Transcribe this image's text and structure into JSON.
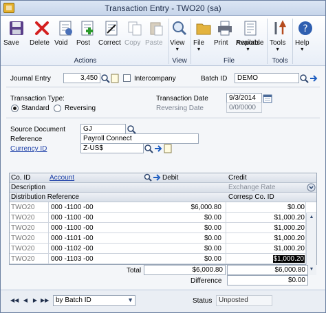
{
  "window": {
    "title": "Transaction Entry  -  TWO20 (sa)"
  },
  "ribbon": {
    "save": "Save",
    "delete": "Delete",
    "void": "Void",
    "post": "Post",
    "correct": "Correct",
    "copy": "Copy",
    "paste": "Paste",
    "view": "View",
    "file": "File",
    "print": "Print",
    "available_reports_1": "Available",
    "available_reports_2": "Reports",
    "tools": "Tools",
    "help": "Help",
    "group_actions": "Actions",
    "group_view": "View",
    "group_file": "File",
    "group_tools": "Tools"
  },
  "header": {
    "journal_entry_label": "Journal Entry",
    "journal_entry_value": "3,450",
    "intercompany_label": "Intercompany",
    "batch_id_label": "Batch ID",
    "batch_id_value": "DEMO",
    "transaction_type_label": "Transaction Type:",
    "standard_label": "Standard",
    "reversing_label": "Reversing",
    "transaction_date_label": "Transaction Date",
    "transaction_date_value": "9/3/2014",
    "reversing_date_label": "Reversing Date",
    "reversing_date_value": "0/0/0000",
    "source_document_label": "Source Document",
    "source_document_value": "GJ",
    "reference_label": "Reference",
    "reference_value": "Payroll Connect",
    "currency_id_label": "Currency ID",
    "currency_id_value": "Z-US$"
  },
  "grid": {
    "headers": {
      "co_id": "Co. ID",
      "account": "Account",
      "debit": "Debit",
      "credit": "Credit",
      "description": "Description",
      "exchange_rate": "Exchange Rate",
      "distribution_reference": "Distribution Reference",
      "corresp_co_id": "Corresp Co. ID"
    },
    "rows": [
      {
        "co": "TWO20",
        "account": "000 -1100 -00",
        "debit": "$6,000.80",
        "credit": "$0.00"
      },
      {
        "co": "TWO20",
        "account": "000 -1100 -00",
        "debit": "$0.00",
        "credit": "$1,000.20"
      },
      {
        "co": "TWO20",
        "account": "000 -1100 -00",
        "debit": "$0.00",
        "credit": "$1,000.20"
      },
      {
        "co": "TWO20",
        "account": "000 -1101 -00",
        "debit": "$0.00",
        "credit": "$1,000.20"
      },
      {
        "co": "TWO20",
        "account": "000 -1102 -00",
        "debit": "$0.00",
        "credit": "$1,000.20"
      },
      {
        "co": "TWO20",
        "account": "000 -1103 -00",
        "debit": "$0.00",
        "credit": "$1,000.20"
      }
    ],
    "total_label": "Total",
    "total_debit": "$6,000.80",
    "total_credit": "$6,000.80",
    "difference_label": "Difference",
    "difference_debit": "$0.00",
    "difference_credit": "$0.00"
  },
  "footer": {
    "sort_by": "by Batch ID",
    "status_label": "Status",
    "status_value": "Unposted"
  },
  "colors": {
    "accent": "#1c3fa8",
    "ribbon_bg": "#e8eef7",
    "title_bg": "#c7d5ea"
  }
}
